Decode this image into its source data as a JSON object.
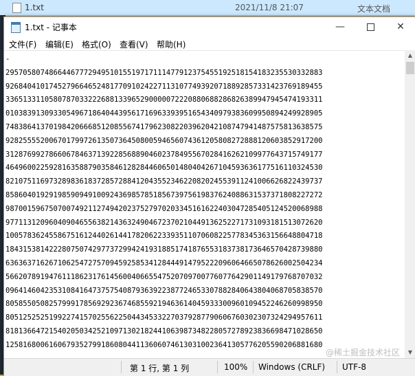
{
  "explorer": {
    "file_name": "1.txt",
    "modified": "2021/11/8 21:07",
    "file_type": "文本文档"
  },
  "window": {
    "title": "1.txt - 记事本",
    "minimize_glyph": "—",
    "close_glyph": "✕"
  },
  "menu": {
    "items": [
      "文件(F)",
      "编辑(E)",
      "格式(O)",
      "查看(V)",
      "帮助(H)"
    ]
  },
  "editor": {
    "lines": [
      "-",
      "2957058074866446777294951015519717111477912375455192518154183235530332883",
      "9268404101745279664652481770910242271131077493920718892857331423769189455",
      "3365133110580787033222688133965290000072220880688286826389947945474193311",
      "0103839130933054967186404439561716963393951654340979383609950894249928905",
      "7483864137019842066685120855674179623082203962042108747941487575813638575",
      "9282555520067017997261350736450800594656074361205808272888120603852917200",
      "3128769927866067846371392285688904602378495567028416262109977643715749177",
      "4649600225928163588790358461282844606501480404267104593636177516110324530",
      "8210751169732898361837285728841204355234622082024553911241006626822439737",
      "8586040192919859094910092436985785185673975619837624088631537371808227272",
      "9870015967507007492112749420237527970203345161622403047285405124520068988",
      "9771131209604090465563821436324904672370210449136252271731093181513072620",
      "1005783624558675161244026144178206223393511070608225778345363156648804718",
      "1843153814222807507429773729942419318851741876553183738173646570428739880",
      "6363637162671062547275709459258534128444914795222096064665078626002504234",
      "5662078919476111862317614560040665547520709700776077642901149179768707032",
      "0964146042353108416473757540879363922387724653307882840643804068705838570",
      "8058550508257999178569292367468559219463614045933300960109452246260998950",
      "8051252525199227415702556225044345332270379287790606760302307324294957611",
      "8181366472154020503425210971302182441063987348228057278923836698471028650",
      "1258168006160679352799186080441136060746130310023641305776205590206881680"
    ]
  },
  "statusbar": {
    "position": "第 1 行, 第 1 列",
    "zoom": "100%",
    "line_ending": "Windows (CRLF)",
    "encoding": "UTF-8"
  },
  "watermark": "@稀土掘金技术社区"
}
